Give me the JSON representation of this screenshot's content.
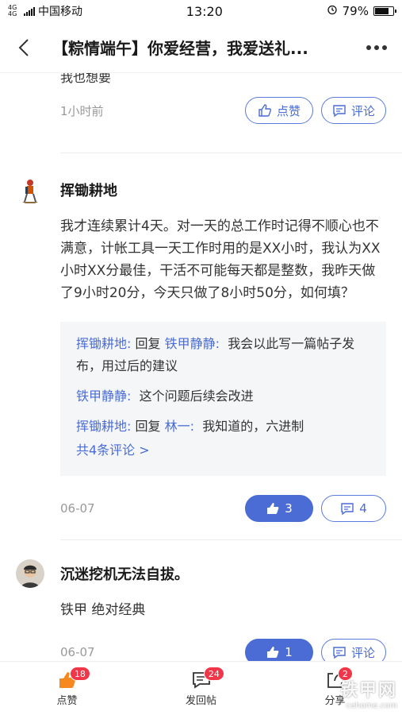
{
  "status_bar": {
    "network": "4G 4G",
    "carrier": "中国移动",
    "time": "13:20",
    "battery": "79%",
    "battery_level": 0.79
  },
  "nav": {
    "title": "【粽情端午】你爱经营，我爱送礼..."
  },
  "prev_comment": {
    "cut_text": "我也想要",
    "time": "1小时前",
    "like_label": "点赞",
    "comment_label": "评论"
  },
  "comment1": {
    "username": "挥锄耕地",
    "body": "我才连续累计4天。对一天的总工作时记得不顺心也不满意，计帐工具一天工作时用的是XX小时，我认为XX小时XX分最佳，干活不可能每天都是整数，我昨天做了9小时20分，今天只做了8小时50分，如何填？",
    "replies": [
      {
        "from": "挥锄耕地",
        "sep1": ": ",
        "kw": "回复",
        "to": "铁甲静静",
        "sep2": ": ",
        "text": "我会以此写一篇帖子发布，用过后的建议"
      },
      {
        "from": "铁甲静静",
        "sep1": ": ",
        "text": "这个问题后续会改进"
      },
      {
        "from": "挥锄耕地",
        "sep1": ": ",
        "kw": "回复",
        "to": "林一",
        "sep2": ": ",
        "text": "我知道的，六进制"
      }
    ],
    "more_label": "共4条评论 >",
    "time": "06-07",
    "likes": "3",
    "comments": "4"
  },
  "comment2": {
    "username": "沉迷挖机无法自拔。",
    "body": "铁甲 绝对经典",
    "time": "06-07",
    "likes": "1",
    "comment_label": "评论"
  },
  "bottom_bar": {
    "like": {
      "label": "点赞",
      "badge": "18"
    },
    "reply": {
      "label": "发回帖",
      "badge": "24"
    },
    "share": {
      "label": "分享",
      "badge": "2"
    }
  },
  "watermark": {
    "line1": "铁甲网",
    "line2": "cehome.com"
  },
  "colors": {
    "accent": "#4a6cd4",
    "badge": "#f2364a",
    "like_icon": "#f7871f"
  }
}
